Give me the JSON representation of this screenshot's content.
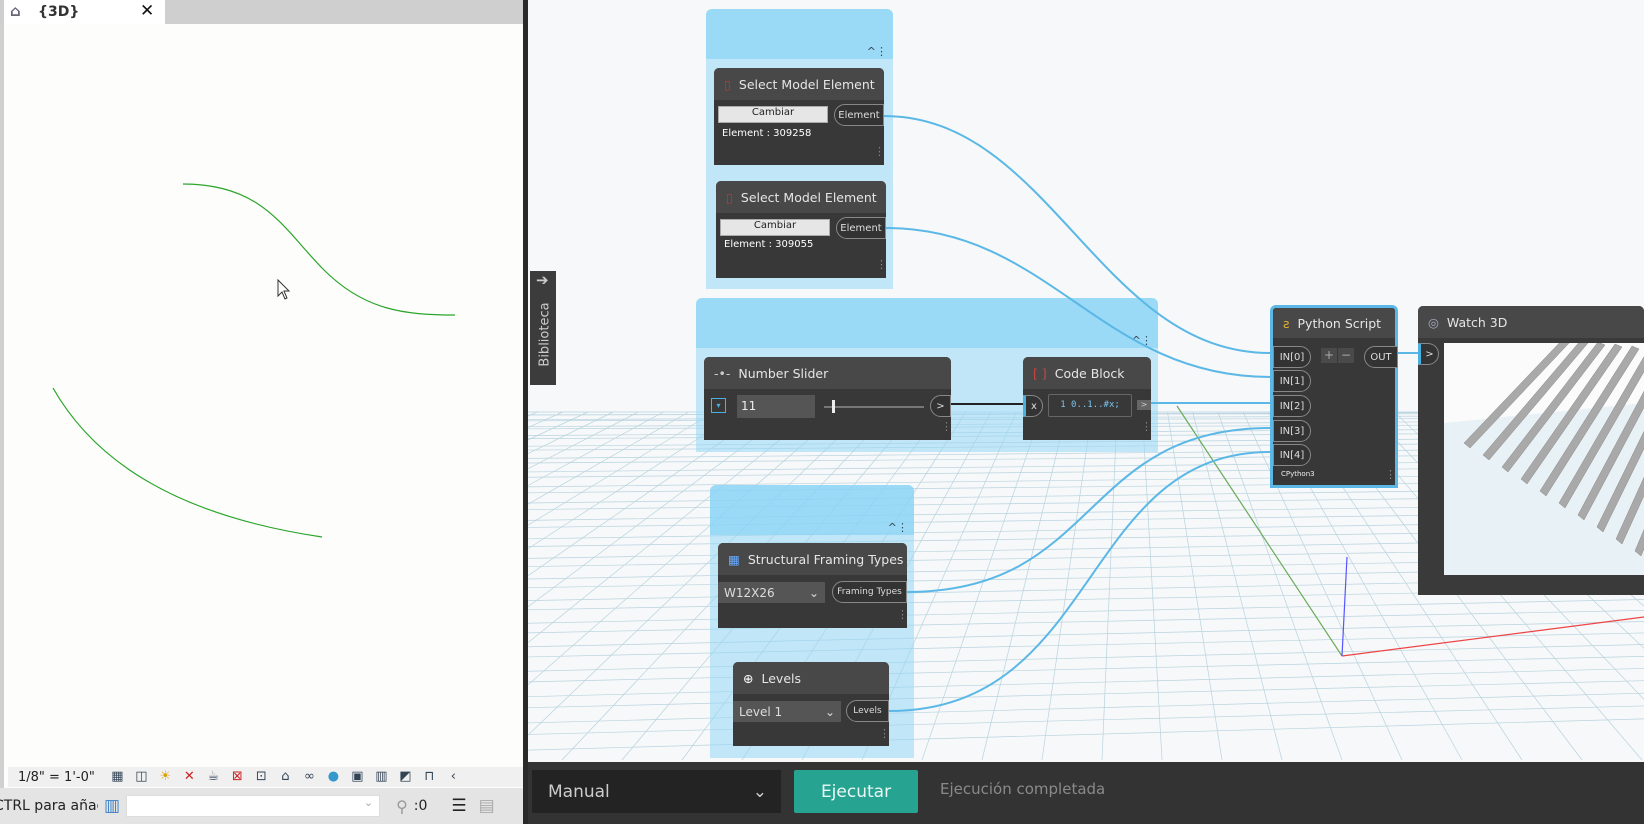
{
  "revit": {
    "tab": {
      "title": "{3D}",
      "icon": "house-3d-icon",
      "close": "✕"
    },
    "scale": "1/8\" = 1'-0\"",
    "view_icons": [
      "detail-level-icon",
      "visual-style-icon",
      "sun-path-icon",
      "shadows-icon",
      "render-icon",
      "crop-view-icon",
      "show-crop-icon",
      "lock-view-icon",
      "temporary-hide-icon",
      "reveal-hidden-icon",
      "temporary-view-properties-icon",
      "highlight-displacement-icon",
      "analytical-model-icon",
      "constraints-icon",
      "collapse-icon"
    ],
    "status_text": "CTRL para añadir",
    "filter_count": ":0"
  },
  "dynamo": {
    "library_label": "Biblioteca",
    "nodes": {
      "select1": {
        "title": "Select Model Element",
        "button": "Cambiar",
        "output": "Element",
        "value": "Element : 309258"
      },
      "select2": {
        "title": "Select Model Element",
        "button": "Cambiar",
        "output": "Element",
        "value": "Element : 309055"
      },
      "slider": {
        "title": "Number Slider",
        "value": "11",
        "output": ">"
      },
      "codeblock": {
        "title": "Code Block",
        "input": "x",
        "code": "1 0..1..#x;",
        "output": ">"
      },
      "framing": {
        "title": "Structural Framing Types",
        "selected": "W12X26",
        "output": "Framing Types"
      },
      "levels": {
        "title": "Levels",
        "selected": "Level 1",
        "output": "Levels"
      },
      "python": {
        "title": "Python Script",
        "inputs": [
          "IN[0]",
          "IN[1]",
          "IN[2]",
          "IN[3]",
          "IN[4]"
        ],
        "add": "+",
        "remove": "−",
        "output": "OUT",
        "engine": "CPython3"
      },
      "watch3d": {
        "title": "Watch 3D",
        "input": ">"
      }
    },
    "run_mode": "Manual",
    "run_button": "Ejecutar",
    "run_status": "Ejecución completada",
    "colors": {
      "wire": "#5bb8e6",
      "group": "#96d7f5",
      "run_button": "#26a391",
      "node": "#383838"
    }
  }
}
